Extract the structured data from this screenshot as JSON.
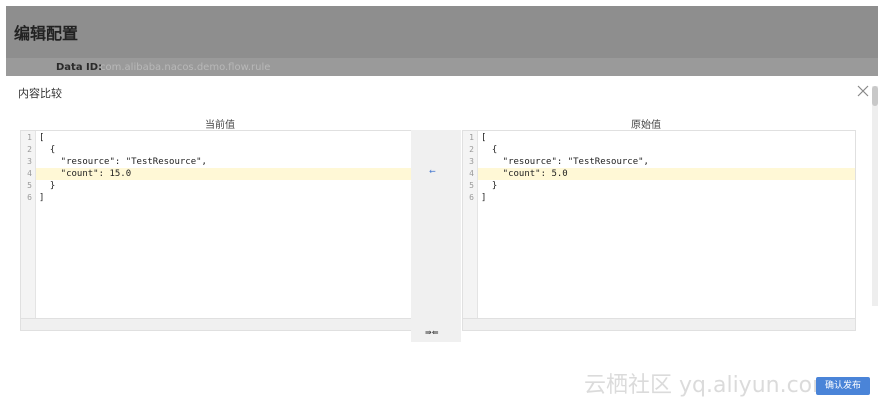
{
  "page": {
    "title": "编辑配置",
    "data_id_label": "Data ID:",
    "data_id_value": "com.alibaba.nacos.demo.flow.rule"
  },
  "modal": {
    "title": "内容比较",
    "current_label": "当前值",
    "original_label": "原始值",
    "confirm_label": "确认发布"
  },
  "left_lines": [
    "[",
    "  {",
    "    \"resource\": \"TestResource\",",
    "    \"count\": 15.0",
    "  }",
    "]"
  ],
  "right_lines": [
    "[",
    "  {",
    "    \"resource\": \"TestResource\",",
    "    \"count\": 5.0",
    "  }",
    "]"
  ],
  "line_numbers": [
    "1",
    "2",
    "3",
    "4",
    "5",
    "6"
  ],
  "merge_arrow": "⇜",
  "merge_controls": "⇛⇚",
  "watermark": "云栖社区 yq.aliyun.com",
  "icons": [
    "close-icon"
  ],
  "colors": {
    "accent": "#4a84d8",
    "diff_highlight": "#fff8d6"
  }
}
